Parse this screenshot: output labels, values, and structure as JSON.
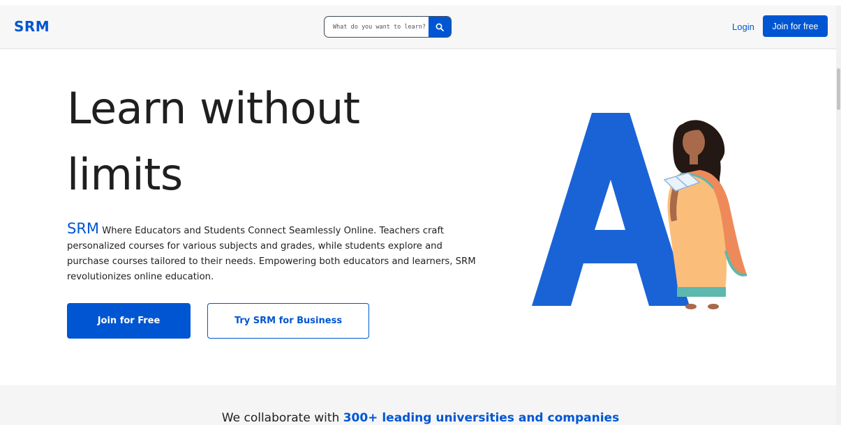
{
  "header": {
    "logo": "SRM",
    "search_placeholder": "What do you want to learn?",
    "login_label": "Login",
    "join_label": "Join for free"
  },
  "hero": {
    "title_line1": "Learn without",
    "title_line2": "limits",
    "brand": "SRM",
    "description": "Where Educators and Students Connect Seamlessly Online. Teachers craft personalized courses for various subjects and grades, while students explore and purchase courses tailored to their needs. Empowering both educators and learners, SRM revolutionizes online education.",
    "primary_cta": "Join for Free",
    "secondary_cta": "Try SRM for Business"
  },
  "collab": {
    "prefix": "We collaborate with",
    "highlight": "300+ leading universities and companies"
  },
  "colors": {
    "brand_blue": "#0056d2",
    "text_dark": "#1f1f1f",
    "header_bg": "#f7f7f7"
  },
  "icons": {
    "search": "search-icon"
  }
}
